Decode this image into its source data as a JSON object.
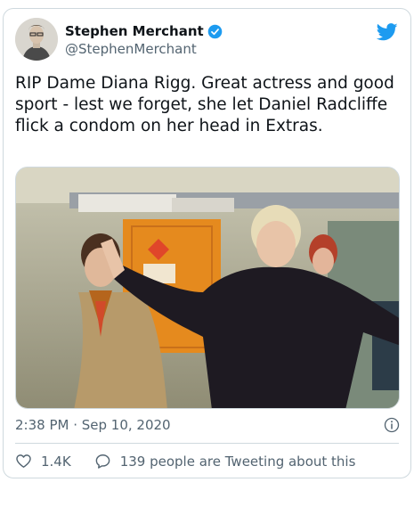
{
  "author": {
    "name": "Stephen Merchant",
    "handle": "@StephenMerchant",
    "verified": true
  },
  "tweet": {
    "text": "RIP Dame Diana Rigg. Great actress and good sport - lest we forget, she let Daniel Radcliffe flick a condom on her head in Extras.",
    "timestamp": "2:38 PM · Sep 10, 2020"
  },
  "actions": {
    "likes": "1.4K",
    "replies_label": "139 people are Tweeting about this"
  },
  "colors": {
    "twitter_blue": "#1d9bf0",
    "secondary_text": "#536471",
    "border": "#cfd9de"
  },
  "icons": {
    "brand": "twitter-bird-icon",
    "verified": "verified-badge-icon",
    "info": "info-icon",
    "like": "heart-icon",
    "reply": "speech-bubble-icon"
  }
}
